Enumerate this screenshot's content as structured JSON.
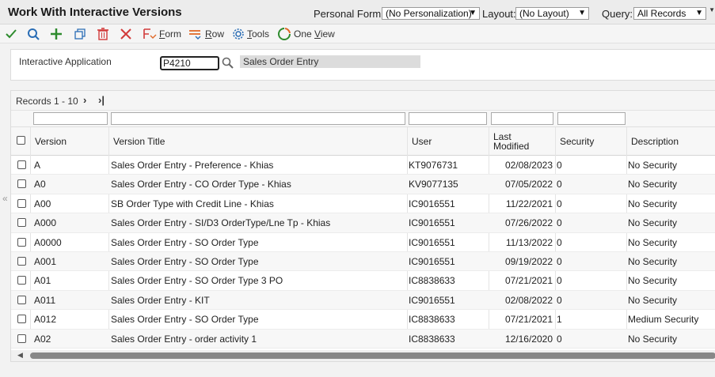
{
  "header": {
    "title": "Work With Interactive Versions",
    "personal_form_label": "Personal Form:",
    "personal_form_value": "(No Personalization)",
    "layout_label": "Layout:",
    "layout_value": "(No Layout)",
    "query_label": "Query:",
    "query_value": "All Records"
  },
  "toolbar": {
    "form_label": "Form",
    "row_label": "Row",
    "tools_label": "Tools",
    "one_view_label": "One View"
  },
  "qbe": {
    "label": "Interactive Application",
    "value": "P4210",
    "description": "Sales Order Entry"
  },
  "grid": {
    "records_label": "Records 1 - 10",
    "columns": {
      "version": "Version",
      "version_title": "Version Title",
      "user": "User",
      "last_modified_1": "Last",
      "last_modified_2": "Modified",
      "security": "Security",
      "description": "Description"
    },
    "rows": [
      {
        "version": "A",
        "title": "Sales Order Entry - Preference - Khias",
        "user": "KT9076731",
        "modified": "02/08/2023",
        "security": "0",
        "description": "No Security"
      },
      {
        "version": "A0",
        "title": "Sales Order Entry - CO Order Type - Khias",
        "user": "KV9077135",
        "modified": "07/05/2022",
        "security": "0",
        "description": "No Security"
      },
      {
        "version": "A00",
        "title": "SB Order Type with Credit Line - Khias",
        "user": "IC9016551",
        "modified": "11/22/2021",
        "security": "0",
        "description": "No Security"
      },
      {
        "version": "A000",
        "title": "Sales Order Entry - SI/D3 OrderType/Lne Tp - Khias",
        "user": "IC9016551",
        "modified": "07/26/2022",
        "security": "0",
        "description": "No Security"
      },
      {
        "version": "A0000",
        "title": "Sales Order Entry - SO Order Type",
        "user": "IC9016551",
        "modified": "11/13/2022",
        "security": "0",
        "description": "No Security"
      },
      {
        "version": "A001",
        "title": "Sales Order Entry - SO Order Type",
        "user": "IC9016551",
        "modified": "09/19/2022",
        "security": "0",
        "description": "No Security"
      },
      {
        "version": "A01",
        "title": "Sales Order Entry - SO Order Type 3 PO",
        "user": "IC8838633",
        "modified": "07/21/2021",
        "security": "0",
        "description": "No Security"
      },
      {
        "version": "A011",
        "title": "Sales Order Entry - KIT",
        "user": "IC9016551",
        "modified": "02/08/2022",
        "security": "0",
        "description": "No Security"
      },
      {
        "version": "A012",
        "title": "Sales Order Entry - SO Order Type",
        "user": "IC8838633",
        "modified": "07/21/2021",
        "security": "1",
        "description": "Medium Security"
      },
      {
        "version": "A02",
        "title": "Sales Order Entry - order activity 1",
        "user": "IC8838633",
        "modified": "12/16/2020",
        "security": "0",
        "description": "No Security"
      }
    ]
  },
  "colors": {
    "check_green": "#2e8b2e",
    "search_blue": "#2a6db5",
    "delete_red": "#d23b3b",
    "accent_orange": "#e06a2a"
  }
}
